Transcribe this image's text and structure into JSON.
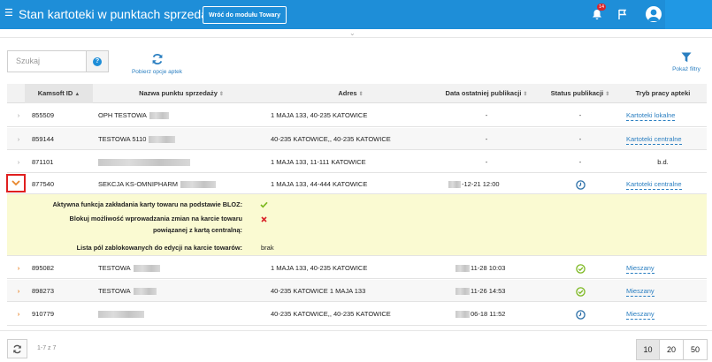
{
  "header": {
    "title": "Stan kartoteki w punktach sprzedaży",
    "back_button": "Wróć do modułu Towary",
    "notifications": "14"
  },
  "toolbar": {
    "search_placeholder": "Szukaj",
    "refresh_label": "Pobierz opcje aptek",
    "filters_label": "Pokaż filtry"
  },
  "table": {
    "columns": [
      "Kamsoft ID",
      "Nazwa punktu sprzedaży",
      "Adres",
      "Data ostatniej publikacji",
      "Status publikacji",
      "Tryb pracy apteki"
    ],
    "rows": [
      {
        "id": "855509",
        "name": "OPH TESTOWA",
        "address": "1 MAJA 133, 40-235 KATOWICE",
        "date": "-",
        "status": "-",
        "mode": "Kartoteki lokalne"
      },
      {
        "id": "859144",
        "name": "TESTOWA 5110",
        "address": "40-235 KATOWICE,, 40-235 KATOWICE",
        "date": "-",
        "status": "-",
        "mode": "Kartoteki centralne"
      },
      {
        "id": "871101",
        "name": "",
        "address": "1 MAJA 133, 11-111 KATOWICE",
        "date": "-",
        "status": "-",
        "mode": "b.d."
      },
      {
        "id": "877540",
        "name": "SEKCJA KS-OMNIPHARM",
        "address": "1 MAJA 133, 44-444 KATOWICE",
        "date": "-12-21 12:00",
        "status": "clock",
        "mode": "Kartoteki centralne"
      },
      {
        "id": "895082",
        "name": "TESTOWA",
        "address": "1 MAJA 133, 40-235 KATOWICE",
        "date": "11-28 10:03",
        "status": "check",
        "mode": "Mieszany"
      },
      {
        "id": "898273",
        "name": "TESTOWA",
        "address": "40-235 KATOWICE 1 MAJA 133",
        "date": "11-26 14:53",
        "status": "check",
        "mode": "Mieszany"
      },
      {
        "id": "910779",
        "name": "",
        "address": "40-235 KATOWICE,, 40-235 KATOWICE",
        "date": "06-18 11:52",
        "status": "clock",
        "mode": "Mieszany"
      }
    ],
    "detail": {
      "label1": "Aktywna funkcja zakładania karty towaru na podstawie BLOZ:",
      "label2a": "Blokuj możliwość wprowadzania zmian na karcie towaru",
      "label2b": "powiązanej z kartą centralną:",
      "label3": "Lista pól zablokowanych do edycji na karcie towarów:",
      "value3": "brak"
    }
  },
  "footer": {
    "page_info": "1-7 z 7",
    "page_sizes": [
      "10",
      "20",
      "50"
    ]
  },
  "colors": {
    "accent": "#1e8ed8",
    "link": "#2b7fc1",
    "detail_bg": "#fafad2",
    "ok": "#7cb820",
    "error": "#d9252b"
  }
}
